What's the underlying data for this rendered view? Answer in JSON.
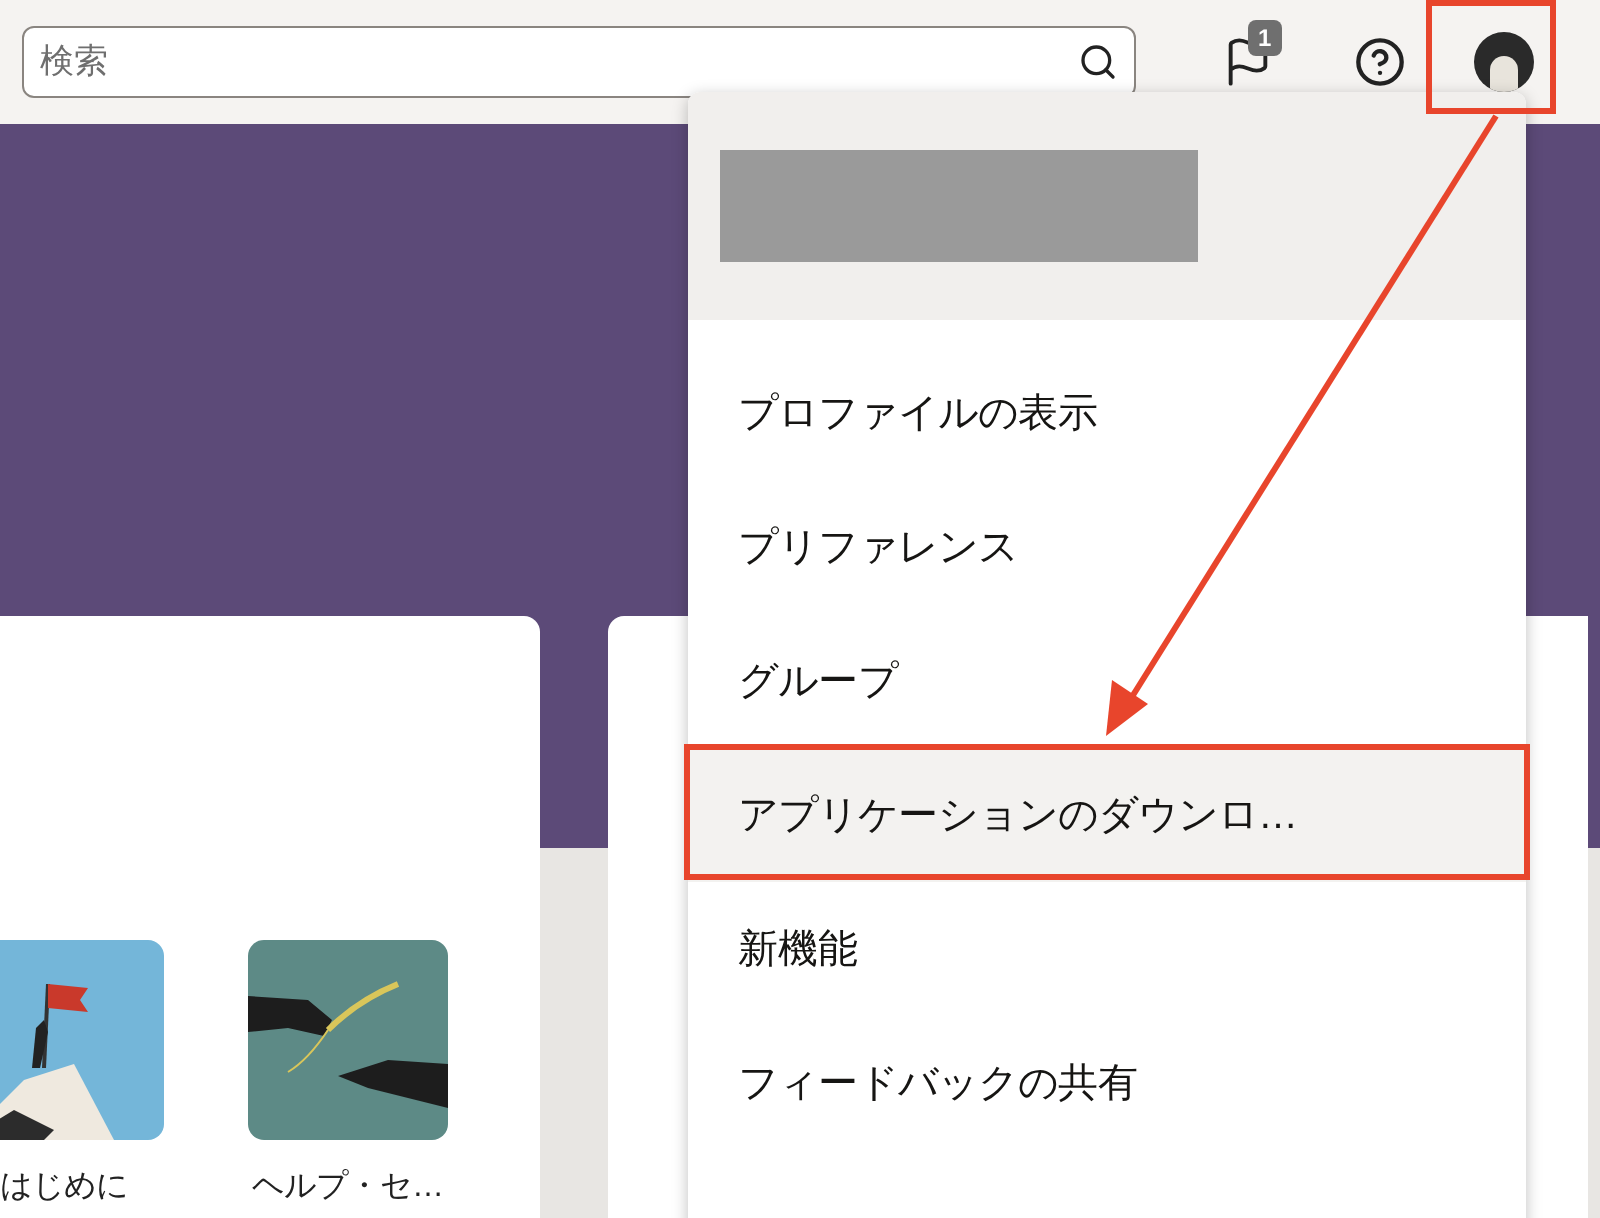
{
  "search": {
    "placeholder": "検索"
  },
  "notifications": {
    "badge": "1"
  },
  "user_menu": {
    "items": [
      {
        "label": "プロファイルの表示",
        "selected": false
      },
      {
        "label": "プリファレンス",
        "selected": false
      },
      {
        "label": "グループ",
        "selected": false
      },
      {
        "label": "アプリケーションのダウンロ…",
        "selected": true
      },
      {
        "label": "新機能",
        "selected": false
      },
      {
        "label": "フィードバックの共有",
        "selected": false
      }
    ]
  },
  "cards": [
    {
      "label": "はじめに",
      "kind": "summit"
    },
    {
      "label": "ヘルプ・セ…",
      "kind": "hands"
    }
  ]
}
